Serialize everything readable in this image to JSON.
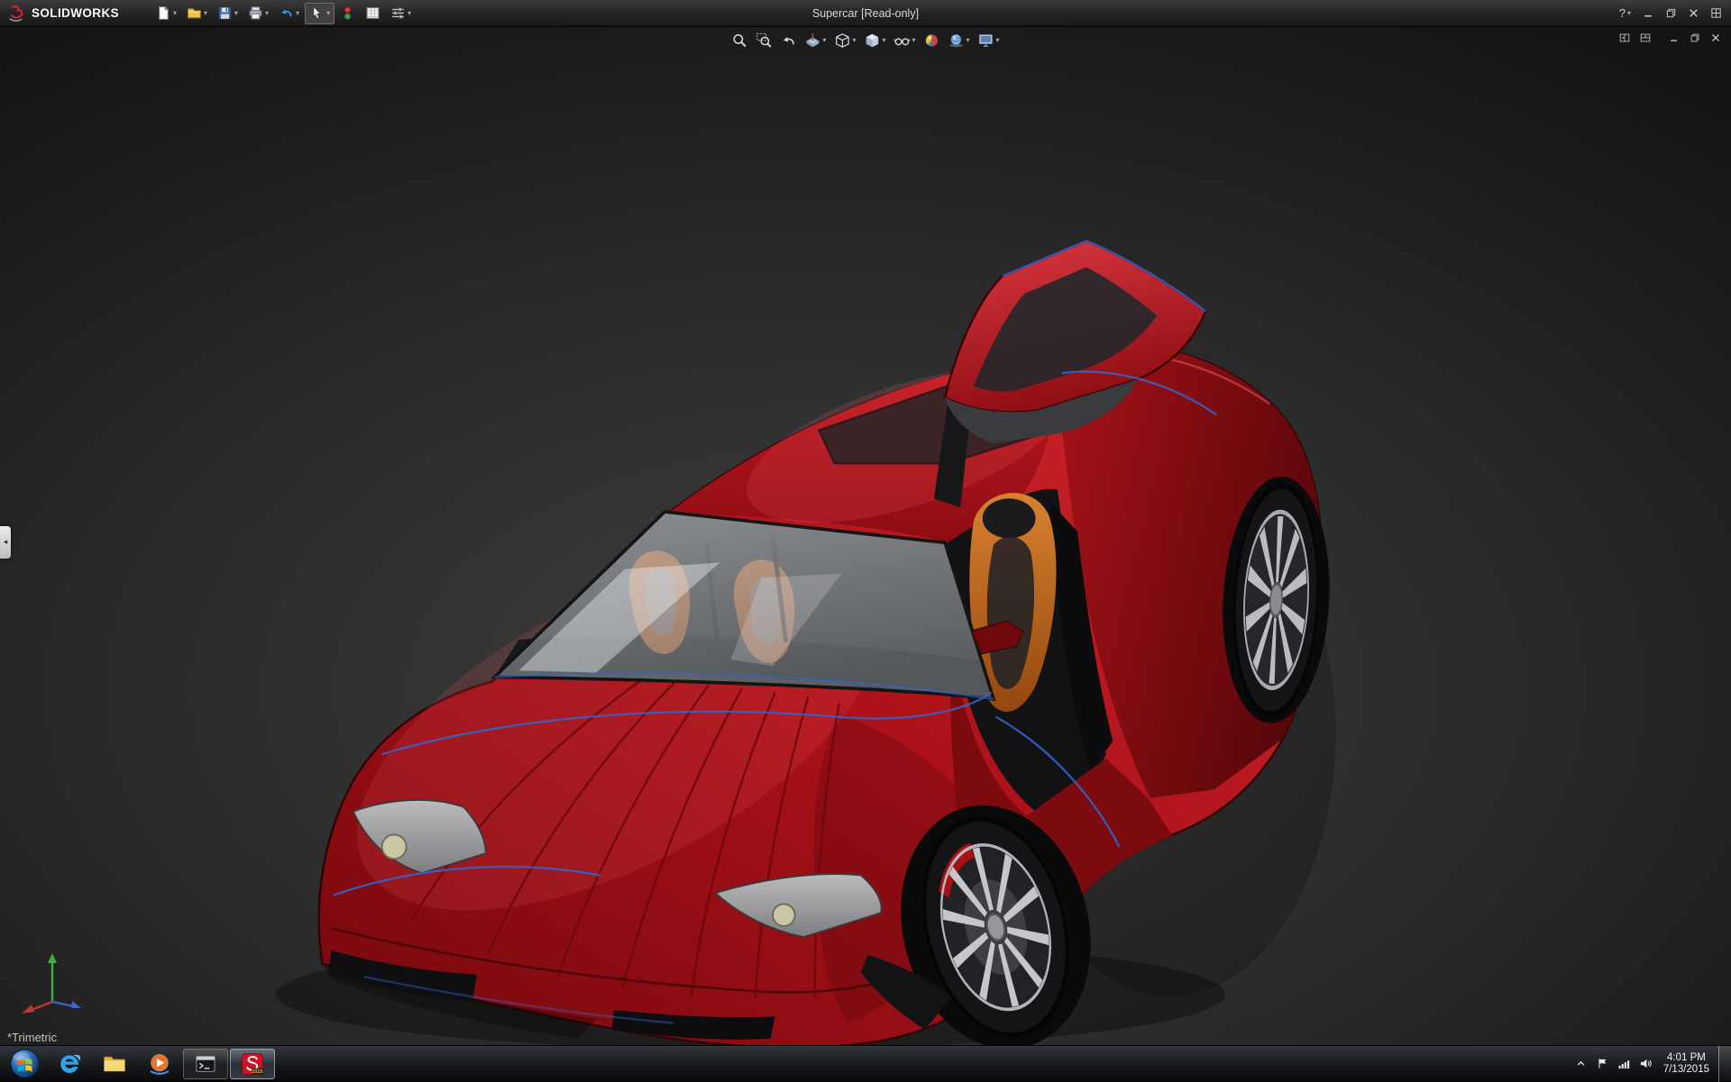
{
  "colors": {
    "car_red": "#b51117",
    "car_red_bright": "#d6232b",
    "car_red_dark": "#74090e",
    "edge_blue": "#3566cc",
    "seat_orange": "#cf6e28",
    "glass_gray": "#a8abae"
  },
  "titlebar": {
    "brand": "SOLIDWORKS",
    "title": "Supercar [Read-only]",
    "help": "?",
    "tools": [
      {
        "name": "new-document-button",
        "icon": "page",
        "dropdown": true
      },
      {
        "name": "open-button",
        "icon": "folder",
        "dropdown": true
      },
      {
        "name": "save-button",
        "icon": "floppy",
        "dropdown": true
      },
      {
        "name": "print-button",
        "icon": "printer",
        "dropdown": true
      },
      {
        "name": "undo-button",
        "icon": "undo",
        "dropdown": true
      },
      {
        "name": "select-button",
        "icon": "cursor",
        "dropdown": true,
        "active": true
      },
      {
        "name": "rebuild-button",
        "icon": "rebuild",
        "dropdown": false
      },
      {
        "name": "file-properties-button",
        "icon": "sheet",
        "dropdown": false
      },
      {
        "name": "options-button",
        "icon": "sliders",
        "dropdown": true
      }
    ],
    "window_controls": [
      {
        "name": "minimize-button",
        "icon": "min"
      },
      {
        "name": "restore-button",
        "icon": "restore"
      },
      {
        "name": "close-button",
        "icon": "close"
      },
      {
        "name": "expand-toolbar-button",
        "icon": "grid"
      }
    ]
  },
  "headsup": {
    "tools": [
      {
        "name": "zoom-to-fit-button",
        "icon": "magnifier",
        "dropdown": false
      },
      {
        "name": "zoom-to-area-button",
        "icon": "magnifier-area",
        "dropdown": false
      },
      {
        "name": "previous-view-button",
        "icon": "prev-view",
        "dropdown": false
      },
      {
        "name": "section-view-button",
        "icon": "section",
        "dropdown": true
      },
      {
        "name": "view-orientation-button",
        "icon": "cube",
        "dropdown": true
      },
      {
        "name": "display-style-button",
        "icon": "cube-shaded",
        "dropdown": true
      },
      {
        "name": "hide-show-items-button",
        "icon": "glasses",
        "dropdown": true
      },
      {
        "name": "edit-appearance-button",
        "icon": "ball",
        "dropdown": false
      },
      {
        "name": "apply-scene-button",
        "icon": "sphere",
        "dropdown": true
      },
      {
        "name": "view-settings-button",
        "icon": "monitor",
        "dropdown": true
      }
    ]
  },
  "viewport": {
    "view_label": "*Trimetric",
    "pane_controls": [
      {
        "name": "split-pane-vertical-button",
        "icon": "pane"
      },
      {
        "name": "split-pane-horizontal-button",
        "icon": "pane2"
      }
    ],
    "window_controls": [
      {
        "name": "document-minimize-button",
        "icon": "min"
      },
      {
        "name": "document-restore-button",
        "icon": "restore"
      },
      {
        "name": "document-close-button",
        "icon": "close"
      }
    ]
  },
  "taskbar": {
    "apps": [
      {
        "name": "start-button",
        "icon": "windows"
      },
      {
        "name": "internet-explorer",
        "icon": "ie"
      },
      {
        "name": "file-explorer",
        "icon": "folder-big"
      },
      {
        "name": "media-player",
        "icon": "wmp"
      },
      {
        "name": "command-prompt",
        "icon": "cmd",
        "open": true
      },
      {
        "name": "solidworks-2015",
        "icon": "sw",
        "open": true,
        "active": true
      }
    ],
    "tray": [
      {
        "name": "show-hidden-icons-button",
        "icon": "caret-up"
      },
      {
        "name": "action-center",
        "icon": "flag"
      },
      {
        "name": "network-status",
        "icon": "network"
      },
      {
        "name": "volume-control",
        "icon": "volume"
      }
    ],
    "clock": {
      "time": "4:01 PM",
      "date": "7/13/2015"
    }
  }
}
